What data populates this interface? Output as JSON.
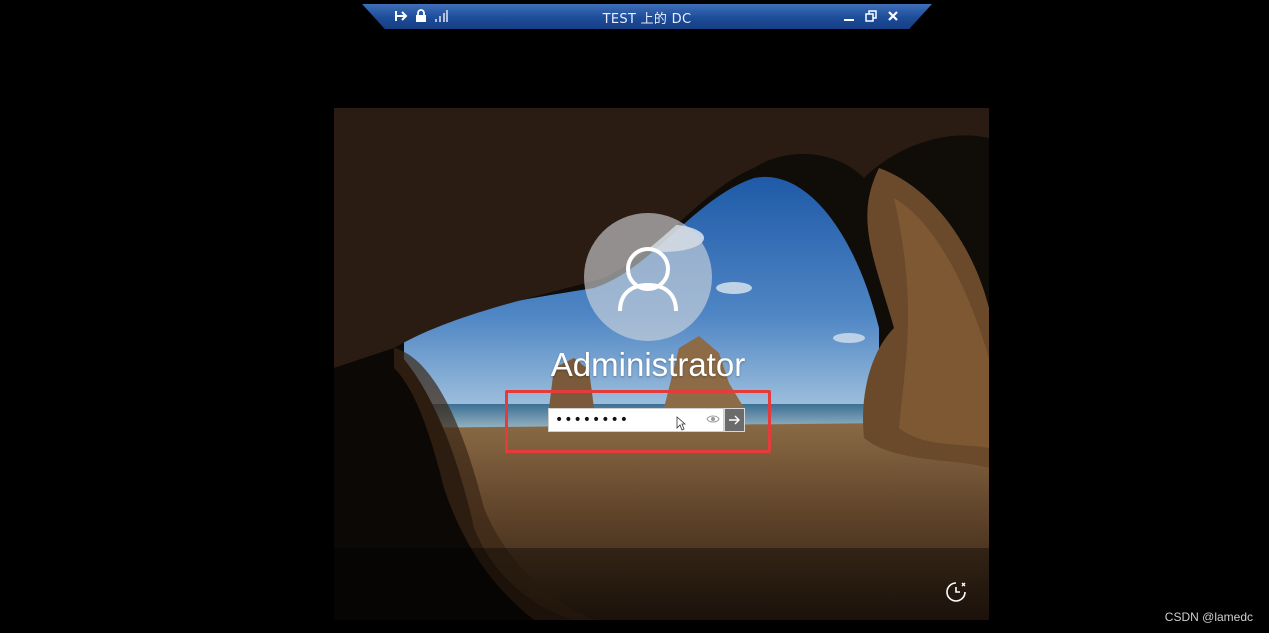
{
  "rdp_bar": {
    "title": "TEST 上的 DC",
    "pin_icon": "pin-icon",
    "lock_icon": "lock-icon",
    "signal_icon": "signal-bars-icon",
    "minimize_icon": "minimize-icon",
    "restore_icon": "restore-icon",
    "close_icon": "close-icon"
  },
  "login": {
    "username": "Administrator",
    "password_value": "••••••••",
    "reveal_icon": "eye-icon",
    "submit_icon": "arrow-right-icon",
    "avatar_icon": "user-icon"
  },
  "system": {
    "ease_of_access_icon": "ease-of-access-icon"
  },
  "watermark": "CSDN @lamedc",
  "colors": {
    "rdp_bar": "#1d4c99",
    "highlight": "#e53b3b"
  }
}
